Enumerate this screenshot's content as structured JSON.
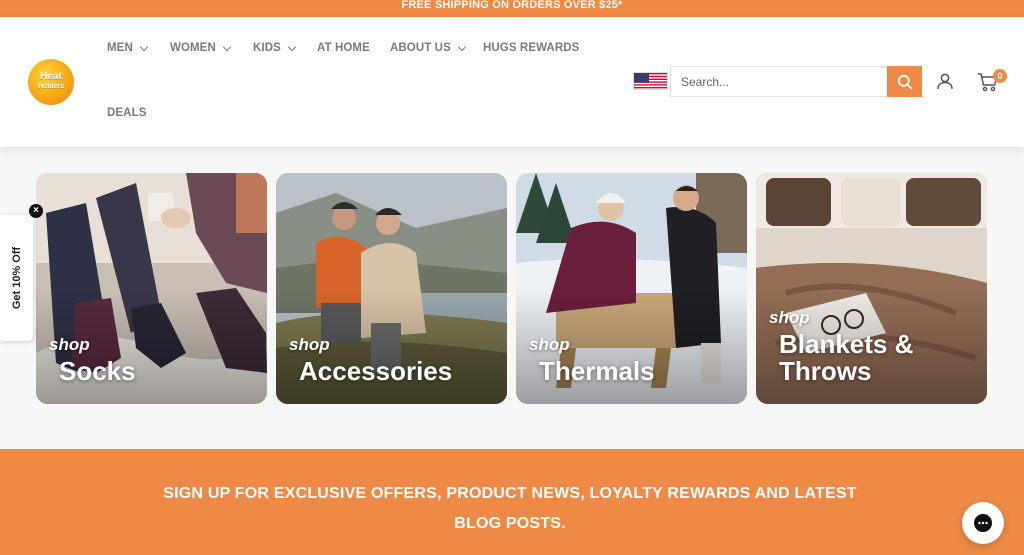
{
  "announcement": {
    "text": "FREE SHIPPING ON ORDERS OVER $25*"
  },
  "brand": {
    "logo_text_1": "Heat",
    "logo_text_2": "Holders"
  },
  "nav": {
    "items": [
      {
        "label": "MEN",
        "has_dropdown": true
      },
      {
        "label": "WOMEN",
        "has_dropdown": true
      },
      {
        "label": "KIDS",
        "has_dropdown": true
      },
      {
        "label": "AT HOME",
        "has_dropdown": false
      },
      {
        "label": "ABOUT US",
        "has_dropdown": true
      },
      {
        "label": "HUGS REWARDS",
        "has_dropdown": false
      },
      {
        "label": "DEALS",
        "has_dropdown": false
      }
    ]
  },
  "header": {
    "search_placeholder": "Search...",
    "search_icon": "search-icon",
    "account_icon": "user-icon",
    "cart_icon": "cart-icon",
    "cart_count": "0",
    "flag": "us-flag-icon"
  },
  "tiles": [
    {
      "prefix": "shop",
      "title_lines": [
        "Socks"
      ]
    },
    {
      "prefix": "shop",
      "title_lines": [
        "Accessories"
      ]
    },
    {
      "prefix": "shop",
      "title_lines": [
        "Thermals"
      ]
    },
    {
      "prefix": "shop",
      "title_lines": [
        "Blankets &",
        "Throws"
      ]
    }
  ],
  "side_tab": {
    "label": "Get 10% Off",
    "close": "×"
  },
  "signup": {
    "line1": "SIGN UP FOR EXCLUSIVE OFFERS, PRODUCT NEWS, LOYALTY REWARDS AND LATEST",
    "line2": "BLOG POSTS."
  },
  "colors": {
    "accent": "#ee8a45",
    "nav_text": "#7b7b7b"
  }
}
